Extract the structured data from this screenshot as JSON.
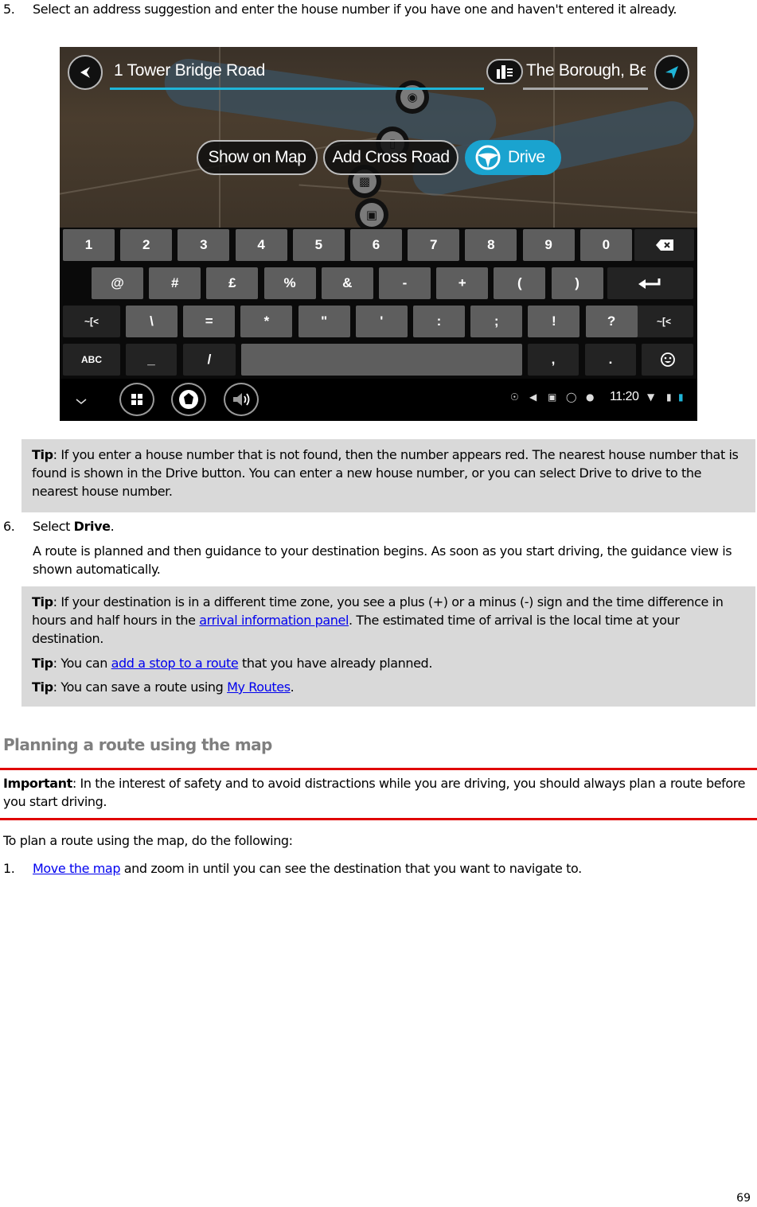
{
  "steps": {
    "step5": {
      "number": "5.",
      "text": "Select an address suggestion and enter the house number if you have one and haven't entered it already."
    },
    "step6": {
      "number": "6.",
      "prefix": "Select ",
      "bold": "Drive",
      "suffix": ".",
      "detail": "A route is planned and then guidance to your destination begins. As soon as you start driving, the guidance view is shown automatically."
    },
    "step1": {
      "number": "1.",
      "link": "Move the map",
      "text": " and zoom in until you can see the destination that you want to navigate to."
    }
  },
  "screenshot": {
    "search_value": "1 Tower Bridge Road",
    "location_value": "The Borough, Be",
    "buttons": {
      "show_on_map": "Show on Map",
      "add_cross_road": "Add Cross Road",
      "drive": "Drive"
    },
    "keyboard": {
      "row1": [
        "1",
        "2",
        "3",
        "4",
        "5",
        "6",
        "7",
        "8",
        "9",
        "0"
      ],
      "row2": [
        "@",
        "#",
        "£",
        "%",
        "&",
        "-",
        "+",
        "(",
        ")"
      ],
      "row3": [
        "\\",
        "=",
        "*",
        "\"",
        "'",
        ":",
        ";",
        "!",
        "?"
      ],
      "symbol_toggle": "~[<",
      "abc": "ABC",
      "row4": [
        "_",
        "/"
      ],
      "comma": ",",
      "period": "."
    },
    "status_bar": {
      "time": "11:20"
    },
    "colors": {
      "accent": "#1aa3cf",
      "underline_active": "#1fb5d8"
    }
  },
  "tips": {
    "tip1": {
      "label": "Tip",
      "text": ": If you enter a house number that is not found, then the number appears red. The nearest house number that is found is shown in the Drive button. You can enter a new house number, or you can select Drive to drive to the nearest house number."
    },
    "tip2": {
      "label": "Tip",
      "pre": ": If your destination is in a different time zone, you see a plus (+) or a minus (-) sign and the time difference in hours and half hours in the ",
      "link": "arrival information panel",
      "post": ". The estimated time of arrival is the local time at your destination."
    },
    "tip3": {
      "label": "Tip",
      "pre": ": You can ",
      "link": "add a stop to a route",
      "post": " that you have already planned."
    },
    "tip4": {
      "label": "Tip",
      "pre": ": You can save a route using ",
      "link": "My Routes",
      "post": "."
    }
  },
  "section": {
    "heading": "Planning a route using the map",
    "important_label": "Important",
    "important_text": ": In the interest of safety and to avoid distractions while you are driving, you should always plan a route before you start driving.",
    "intro": "To plan a route using the map, do the following:"
  },
  "page_number": "69"
}
